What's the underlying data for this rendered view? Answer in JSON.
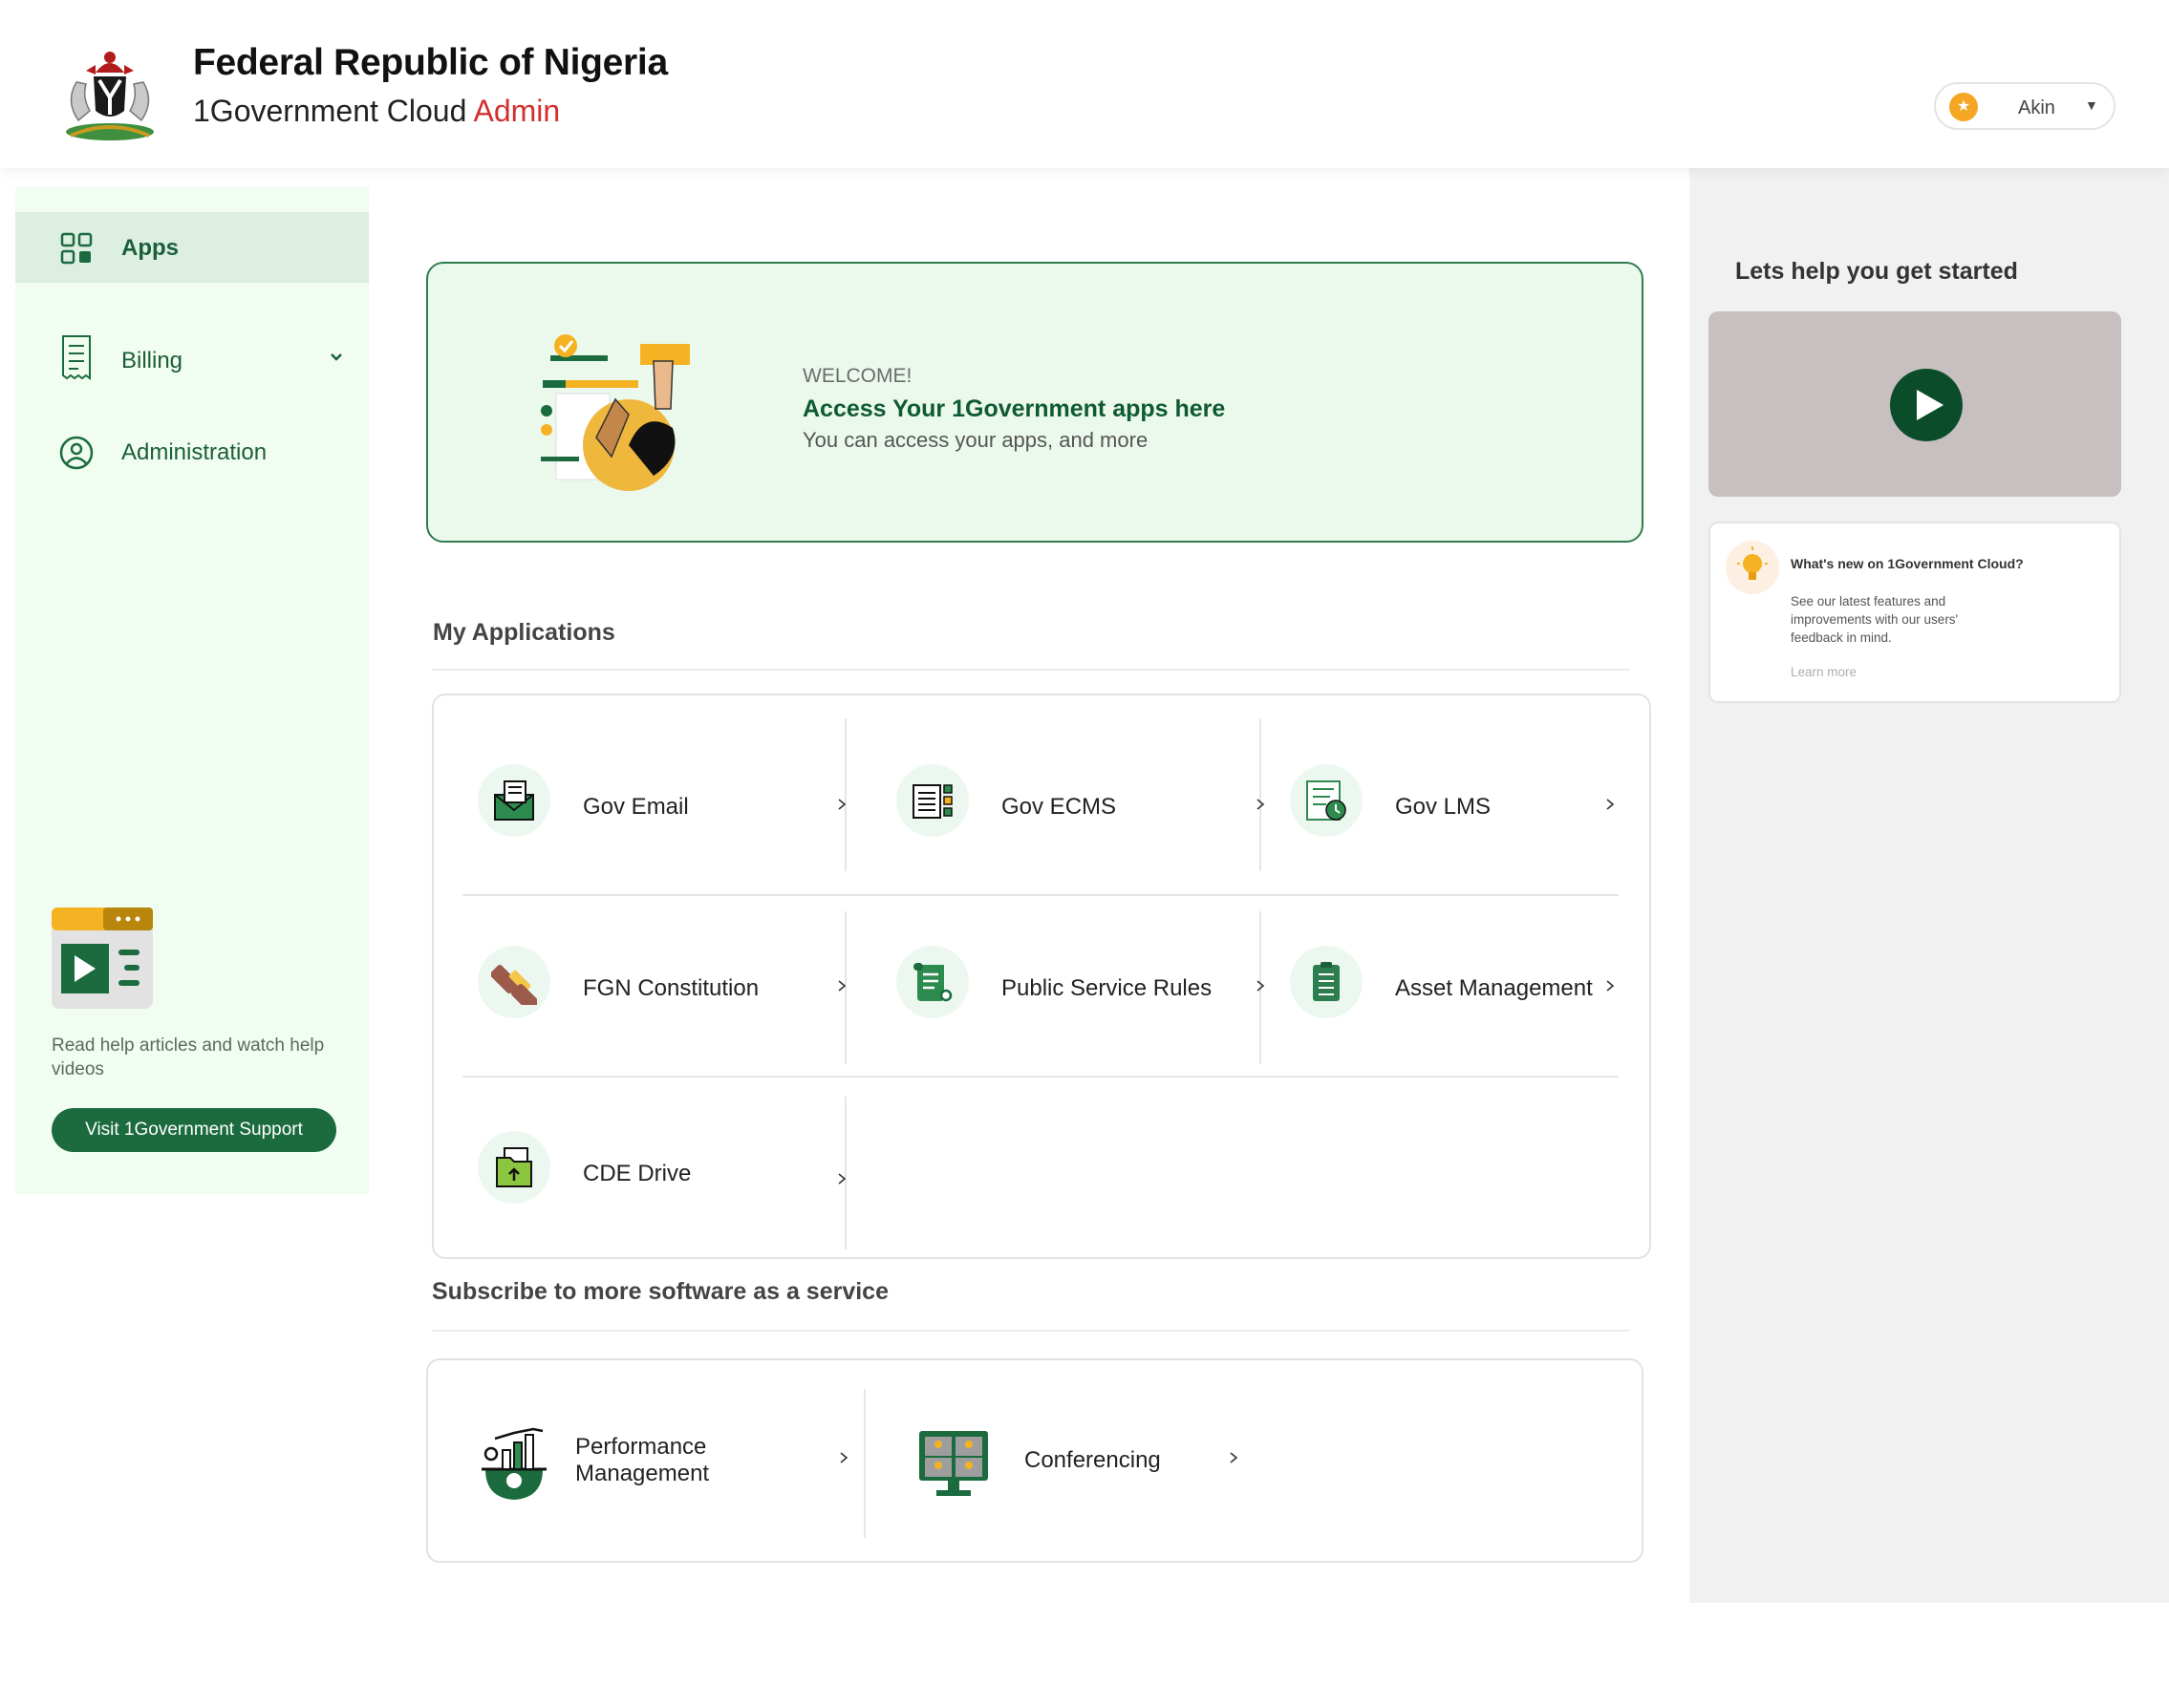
{
  "header": {
    "title": "Federal Republic of Nigeria",
    "subtitle_main": "1Government Cloud",
    "subtitle_accent": "Admin",
    "user_name": "Akin",
    "user_avatar_glyph": "★"
  },
  "sidebar": {
    "items": [
      {
        "label": "Apps",
        "icon": "apps-grid-icon",
        "active": true
      },
      {
        "label": "Billing",
        "icon": "receipt-icon",
        "expandable": true
      },
      {
        "label": "Administration",
        "icon": "user-circle-icon"
      }
    ],
    "help_text": "Read help articles and watch help videos",
    "support_button": "Visit 1Government Support"
  },
  "banner": {
    "kicker": "WELCOME!",
    "headline": "Access Your 1Government apps here",
    "subtext": "You can access your apps, and more"
  },
  "my_applications": {
    "title": "My Applications",
    "apps": [
      {
        "label": "Gov Email",
        "icon": "email-icon"
      },
      {
        "label": "Gov ECMS",
        "icon": "documents-icon"
      },
      {
        "label": "Gov LMS",
        "icon": "learning-icon"
      },
      {
        "label": "FGN Constitution",
        "icon": "gavel-icon"
      },
      {
        "label": "Public Service Rules",
        "icon": "scroll-icon"
      },
      {
        "label": "Asset Management",
        "icon": "clipboard-icon"
      },
      {
        "label": "CDE Drive",
        "icon": "drive-folder-icon"
      }
    ]
  },
  "subscribe": {
    "title": "Subscribe to more software as a service",
    "apps": [
      {
        "label": "Performance Management",
        "icon": "performance-gear-icon"
      },
      {
        "label": "Conferencing",
        "icon": "video-conference-icon"
      }
    ]
  },
  "help_panel": {
    "title": "Lets help you get started",
    "news_title": "What's new on 1Government Cloud?",
    "news_body": "See our latest features and improvements with our users' feedback in mind.",
    "news_link": "Learn more"
  },
  "colors": {
    "brand_green": "#1b6b3f",
    "dark_green": "#0b4d2b",
    "admin_red": "#d32f2f",
    "sidebar_bg": "#f1fdf1",
    "banner_bg": "#ebf9ed",
    "accent_yellow": "#f5a623"
  }
}
